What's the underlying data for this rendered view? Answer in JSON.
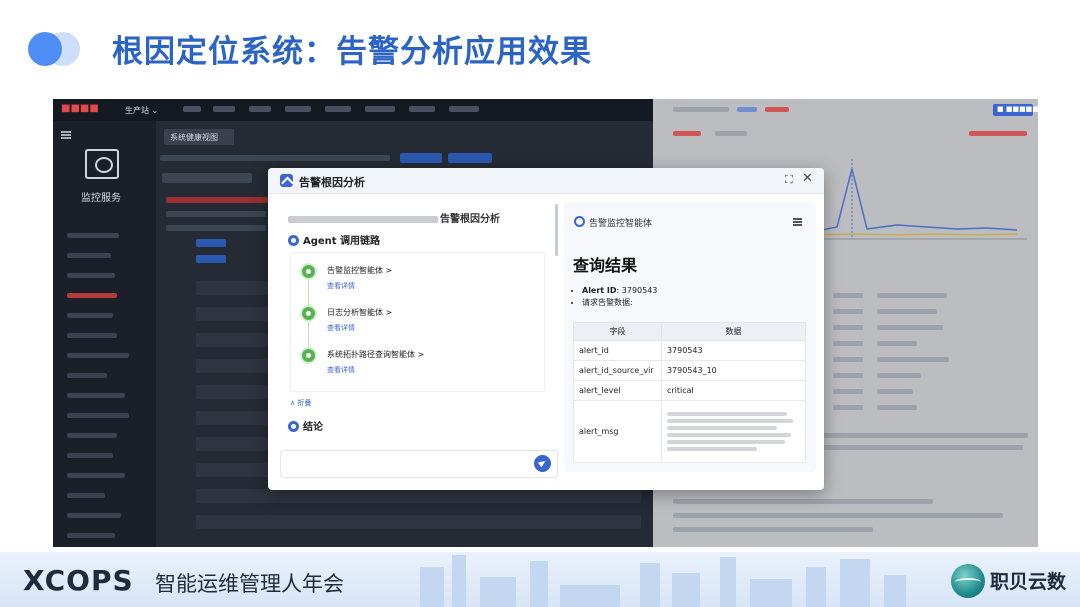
{
  "slide": {
    "title": "根因定位系统：告警分析应用效果"
  },
  "background_app": {
    "brand": "■■■■",
    "env_selector": "生产站 ⌄",
    "sidebar": {
      "module_label": "监控服务"
    },
    "main": {
      "tab_label": "系统健康视图"
    },
    "right_panel": {
      "action_button": "■ ■■■■■"
    }
  },
  "modal": {
    "title": "告警根因分析",
    "expand_icon": "⛶",
    "close_icon": "✕",
    "left": {
      "heading_suffix": "告警根因分析",
      "chain_section": "Agent 调用链路",
      "steps": [
        {
          "name": "告警监控智能体 >",
          "link": "查看详情"
        },
        {
          "name": "日志分析智能体 >",
          "link": "查看详情"
        },
        {
          "name": "系统拓扑路径查询智能体 >",
          "link": "查看详情"
        }
      ],
      "collapse": "∧ 折叠",
      "conclusion_section": "结论"
    },
    "right": {
      "agent_name": "告警监控智能体",
      "result_title": "查询结果",
      "bullet_alert_label": "Alert ID",
      "bullet_alert_value": ": 3790543",
      "bullet_request": "请求告警数据:",
      "table": {
        "headers": [
          "字段",
          "数据"
        ],
        "rows": [
          {
            "field": "alert_id",
            "value": "3790543"
          },
          {
            "field": "alert_id_source_vir",
            "value": "3790543_10"
          },
          {
            "field": "alert_level",
            "value": "critical"
          },
          {
            "field": "alert_msg",
            "value": ""
          }
        ]
      }
    }
  },
  "footer": {
    "brand": "XCOPS",
    "subtitle": "智能运维管理人年会",
    "company": "职贝云数"
  }
}
